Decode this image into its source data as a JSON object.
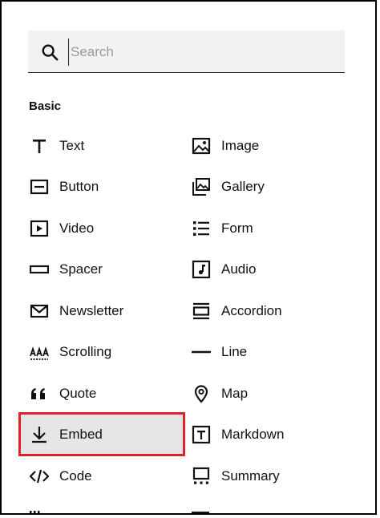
{
  "search": {
    "placeholder": "Search"
  },
  "section": {
    "title": "Basic"
  },
  "items_left": [
    {
      "label": "Text",
      "icon": "text-icon"
    },
    {
      "label": "Button",
      "icon": "button-icon"
    },
    {
      "label": "Video",
      "icon": "video-icon"
    },
    {
      "label": "Spacer",
      "icon": "spacer-icon"
    },
    {
      "label": "Newsletter",
      "icon": "envelope-icon"
    },
    {
      "label": "Scrolling",
      "icon": "scrolling-icon"
    },
    {
      "label": "Quote",
      "icon": "quote-icon"
    },
    {
      "label": "Embed",
      "icon": "download-icon"
    },
    {
      "label": "Code",
      "icon": "code-icon"
    }
  ],
  "items_right": [
    {
      "label": "Image",
      "icon": "image-icon"
    },
    {
      "label": "Gallery",
      "icon": "gallery-icon"
    },
    {
      "label": "Form",
      "icon": "form-list-icon"
    },
    {
      "label": "Audio",
      "icon": "audio-icon"
    },
    {
      "label": "Accordion",
      "icon": "accordion-icon"
    },
    {
      "label": "Line",
      "icon": "line-icon"
    },
    {
      "label": "Map",
      "icon": "map-pin-icon"
    },
    {
      "label": "Markdown",
      "icon": "markdown-icon"
    },
    {
      "label": "Summary",
      "icon": "summary-icon"
    }
  ],
  "selected_item": "Embed",
  "colors": {
    "highlight": "#e0242c",
    "search_bg": "#f2f2f2",
    "selected_bg": "#e6e6e6"
  }
}
